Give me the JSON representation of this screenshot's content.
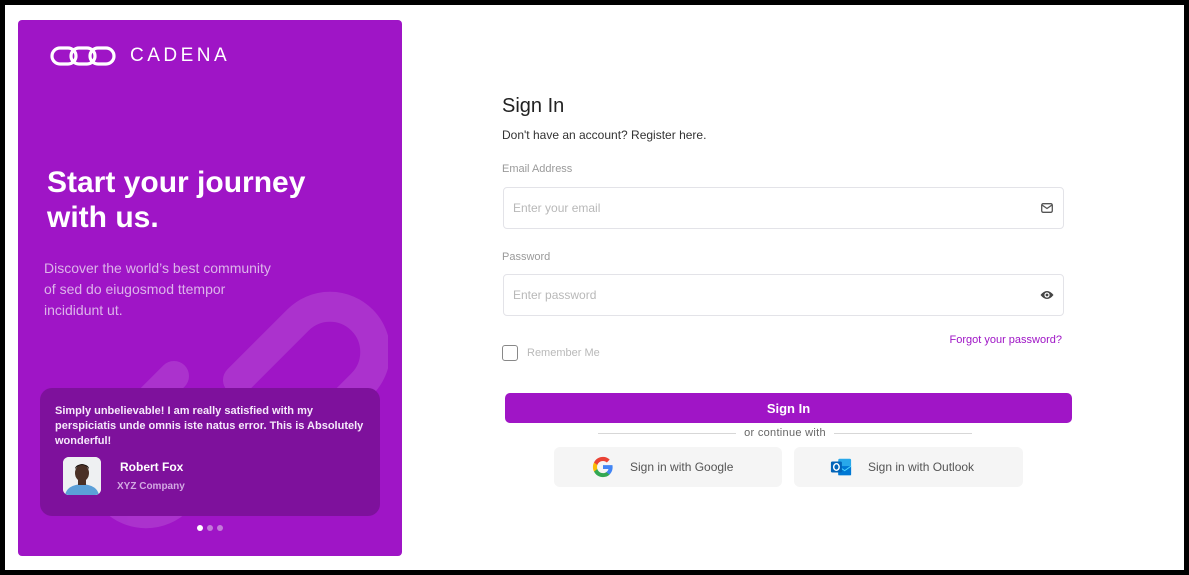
{
  "brand": {
    "name": "CADENA",
    "color": "#9f15c6"
  },
  "hero": {
    "title": "Start your journey with us.",
    "subtitle": "Discover the world’s best community of sed do eiugosmod ttempor incididunt ut.",
    "testimonial": {
      "quote": "Simply unbelievable! I am really satisfied with my perspiciatis unde omnis iste natus error. This is Absolutely wonderful!",
      "author_name": "Robert Fox",
      "author_company": "XYZ Company"
    },
    "carousel": {
      "total": 3,
      "active_index": 0
    }
  },
  "form": {
    "title": "Sign In",
    "register_text": "Don't have an account? Register here.",
    "email": {
      "label": "Email Address",
      "placeholder": "Enter your email",
      "value": "",
      "icon": "envelope-icon"
    },
    "password": {
      "label": "Password",
      "placeholder": "Enter password",
      "value": "",
      "icon": "eye-icon"
    },
    "remember_label": "Remember Me",
    "remember_checked": false,
    "forgot_label": "Forgot your password?",
    "submit_label": "Sign In",
    "divider_text": "or continue with",
    "social": [
      {
        "label": "Sign in with Google",
        "icon": "google-icon"
      },
      {
        "label": "Sign in with Outlook",
        "icon": "outlook-icon"
      }
    ]
  }
}
